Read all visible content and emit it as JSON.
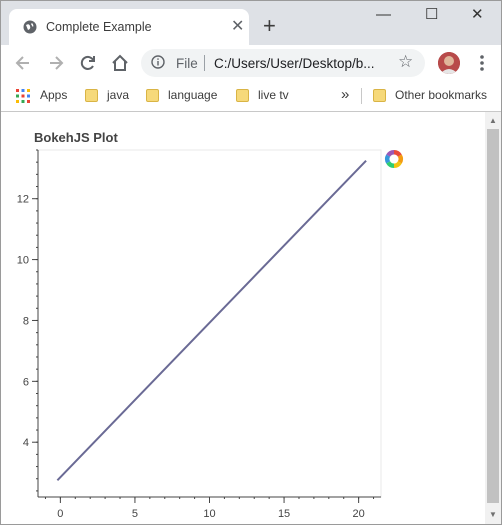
{
  "browser": {
    "tab_title": "Complete Example",
    "new_tab_symbol": "+",
    "close_tab_symbol": "✕",
    "window_controls": {
      "minimize": "—",
      "maximize": "☐",
      "close": "✕"
    },
    "address": {
      "scheme_label": "File",
      "url": "C:/Users/User/Desktop/b..."
    },
    "bookmarks": [
      {
        "label": "Apps",
        "icon": "apps-grid-icon"
      },
      {
        "label": "java",
        "icon": "folder-icon"
      },
      {
        "label": "language",
        "icon": "folder-icon"
      },
      {
        "label": "live tv",
        "icon": "folder-icon"
      }
    ],
    "bookmarks_overflow": "»",
    "other_bookmarks": "Other bookmarks"
  },
  "page": {
    "title": "BokehJS Plot"
  },
  "chart_data": {
    "type": "line",
    "title": "BokehJS Plot",
    "xlabel": "",
    "ylabel": "",
    "xlim": [
      -1.5,
      21.5
    ],
    "ylim": [
      2.2,
      13.6
    ],
    "xticks": [
      0,
      5,
      10,
      15,
      20
    ],
    "yticks": [
      4,
      6,
      8,
      10,
      12
    ],
    "grid": false,
    "series": [
      {
        "x": [
          -0.2,
          20.5
        ],
        "y": [
          2.75,
          13.25
        ],
        "color": "#6a6a95"
      }
    ],
    "toolbar_logo": "bokeh-logo-icon"
  },
  "colors": {
    "tabstrip": "#dee1e6",
    "line": "#6a6a95",
    "scroll_thumb": "#c1c1c1"
  }
}
